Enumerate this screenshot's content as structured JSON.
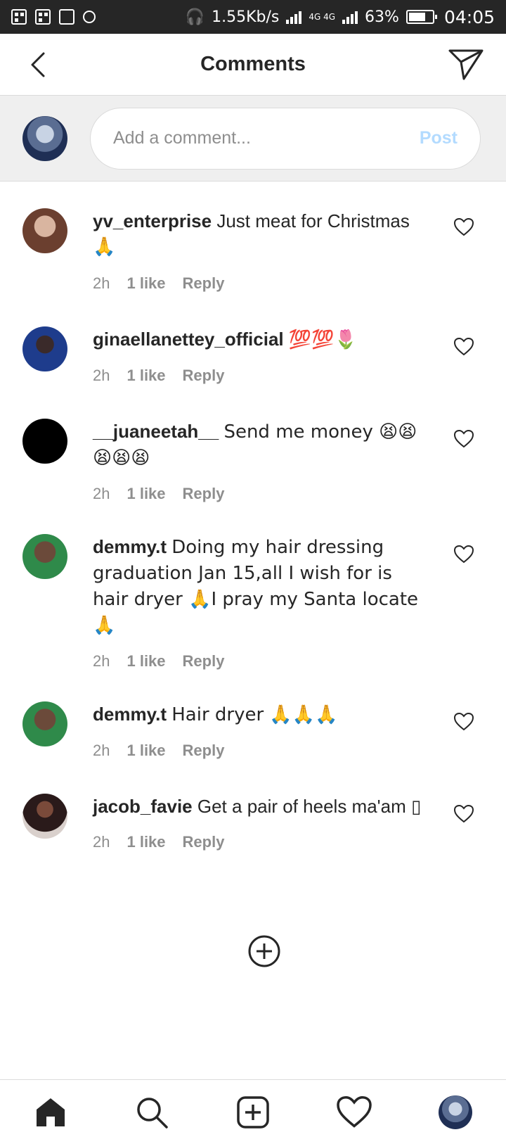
{
  "status_bar": {
    "speed": "1.55Kb/s",
    "network": "4G 4G",
    "battery": "63%",
    "time": "04:05"
  },
  "header": {
    "title": "Comments"
  },
  "composer": {
    "placeholder": "Add a comment...",
    "post_label": "Post"
  },
  "comments": [
    {
      "user": "yv_enterprise",
      "text": "Just meat for Christmas 🙏",
      "time": "2h",
      "likes": "1 like",
      "reply": "Reply",
      "avatar_color": "#7a4a3a"
    },
    {
      "user": "ginaellanettey_official",
      "text": "💯💯🌷",
      "time": "2h",
      "likes": "1 like",
      "reply": "Reply",
      "avatar_color": "#1b2c6b"
    },
    {
      "user": "__juaneetah__",
      "text": "Send me money 😫😫😫😫😫",
      "time": "2h",
      "likes": "1 like",
      "reply": "Reply",
      "avatar_color": "#000000"
    },
    {
      "user": "demmy.t",
      "text": "Doing my hair dressing graduation Jan 15,all I wish for is hair dryer 🙏I pray my Santa locate 🙏",
      "time": "2h",
      "likes": "1 like",
      "reply": "Reply",
      "avatar_color": "#4a7a4a"
    },
    {
      "user": "demmy.t",
      "text": "Hair dryer 🙏🙏🙏",
      "time": "2h",
      "likes": "1 like",
      "reply": "Reply",
      "avatar_color": "#4a7a4a"
    },
    {
      "user": "jacob_favie",
      "text": "Get a pair of heels ma'am ▯",
      "time": "2h",
      "likes": "1 like",
      "reply": "Reply",
      "avatar_color": "#5a2e2e"
    }
  ],
  "nav": [
    "home-icon",
    "search-icon",
    "add-post-icon",
    "activity-heart-icon",
    "profile-avatar"
  ]
}
